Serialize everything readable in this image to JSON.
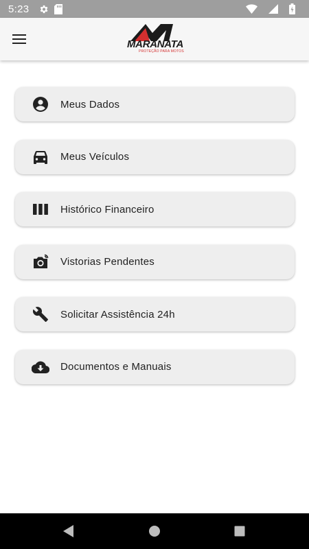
{
  "status_bar": {
    "time": "5:23"
  },
  "app_bar": {
    "logo_text": "MARANATA",
    "logo_tagline": "PROTEÇÃO PARA MOTOS",
    "menu_icon": "hamburger-icon"
  },
  "menu": {
    "items": [
      {
        "label": "Meus Dados",
        "icon": "account-circle-icon"
      },
      {
        "label": "Meus Veículos",
        "icon": "car-icon"
      },
      {
        "label": "Histórico Financeiro",
        "icon": "bars-icon"
      },
      {
        "label": "Vistorias Pendentes",
        "icon": "camera-icon"
      },
      {
        "label": "Solicitar Assistência 24h",
        "icon": "wrench-icon"
      },
      {
        "label": "Documentos e Manuais",
        "icon": "cloud-download-icon"
      }
    ]
  },
  "nav_bar": {
    "back": "back-icon",
    "home": "home-icon",
    "recents": "recents-icon"
  },
  "colors": {
    "accent": "#d32f2f",
    "status_bar": "#9e9e9e",
    "button_bg": "#eeeeee"
  }
}
